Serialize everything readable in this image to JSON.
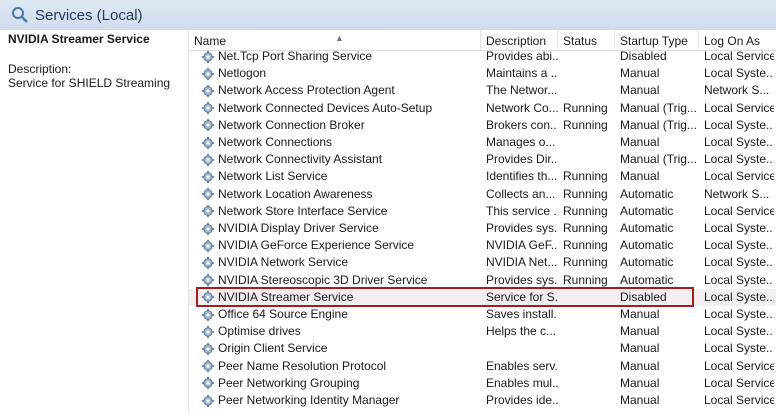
{
  "window": {
    "title": "Services (Local)"
  },
  "left_pane": {
    "service_name": "NVIDIA Streamer Service",
    "description_label": "Description:",
    "description": "Service for SHIELD Streaming"
  },
  "columns": {
    "name": "Name",
    "description": "Description",
    "status": "Status",
    "startup_type": "Startup Type",
    "log_on_as": "Log On As"
  },
  "rows": [
    {
      "name": "Net.Tcp Port Sharing Service",
      "description": "Provides abi...",
      "status": "",
      "startup": "Disabled",
      "logon": "Local Service"
    },
    {
      "name": "Netlogon",
      "description": "Maintains a ...",
      "status": "",
      "startup": "Manual",
      "logon": "Local Syste..."
    },
    {
      "name": "Network Access Protection Agent",
      "description": "The Networ...",
      "status": "",
      "startup": "Manual",
      "logon": "Network S..."
    },
    {
      "name": "Network Connected Devices Auto-Setup",
      "description": "Network Co...",
      "status": "Running",
      "startup": "Manual (Trig...",
      "logon": "Local Service"
    },
    {
      "name": "Network Connection Broker",
      "description": "Brokers con...",
      "status": "Running",
      "startup": "Manual (Trig...",
      "logon": "Local Syste..."
    },
    {
      "name": "Network Connections",
      "description": "Manages o...",
      "status": "",
      "startup": "Manual",
      "logon": "Local Syste..."
    },
    {
      "name": "Network Connectivity Assistant",
      "description": "Provides Dir...",
      "status": "",
      "startup": "Manual (Trig...",
      "logon": "Local Syste..."
    },
    {
      "name": "Network List Service",
      "description": "Identifies th...",
      "status": "Running",
      "startup": "Manual",
      "logon": "Local Service"
    },
    {
      "name": "Network Location Awareness",
      "description": "Collects an...",
      "status": "Running",
      "startup": "Automatic",
      "logon": "Network S..."
    },
    {
      "name": "Network Store Interface Service",
      "description": "This service ...",
      "status": "Running",
      "startup": "Automatic",
      "logon": "Local Service"
    },
    {
      "name": "NVIDIA Display Driver Service",
      "description": "Provides sys...",
      "status": "Running",
      "startup": "Automatic",
      "logon": "Local Syste..."
    },
    {
      "name": "NVIDIA GeForce Experience Service",
      "description": "NVIDIA GeF...",
      "status": "Running",
      "startup": "Automatic",
      "logon": "Local Syste..."
    },
    {
      "name": "NVIDIA Network Service",
      "description": "NVIDIA Net...",
      "status": "Running",
      "startup": "Automatic",
      "logon": "Local Syste..."
    },
    {
      "name": "NVIDIA Stereoscopic 3D Driver Service",
      "description": "Provides sys...",
      "status": "Running",
      "startup": "Automatic",
      "logon": "Local Syste..."
    },
    {
      "name": "NVIDIA Streamer Service",
      "description": "Service for S...",
      "status": "",
      "startup": "Disabled",
      "logon": "Local Syste..."
    },
    {
      "name": "Office 64 Source Engine",
      "description": "Saves install...",
      "status": "",
      "startup": "Manual",
      "logon": "Local Syste..."
    },
    {
      "name": "Optimise drives",
      "description": "Helps the c...",
      "status": "",
      "startup": "Manual",
      "logon": "Local Syste..."
    },
    {
      "name": "Origin Client Service",
      "description": "",
      "status": "",
      "startup": "Manual",
      "logon": "Local Syste..."
    },
    {
      "name": "Peer Name Resolution Protocol",
      "description": "Enables serv...",
      "status": "",
      "startup": "Manual",
      "logon": "Local Service"
    },
    {
      "name": "Peer Networking Grouping",
      "description": "Enables mul...",
      "status": "",
      "startup": "Manual",
      "logon": "Local Service"
    },
    {
      "name": "Peer Networking Identity Manager",
      "description": "Provides ide...",
      "status": "",
      "startup": "Manual",
      "logon": "Local Service"
    }
  ],
  "colors": {
    "highlight_border": "#a31d1d",
    "title_text": "#1e3a5f"
  },
  "icons": {
    "title": "magnifier-gear-icon",
    "service": "gear-icon"
  }
}
